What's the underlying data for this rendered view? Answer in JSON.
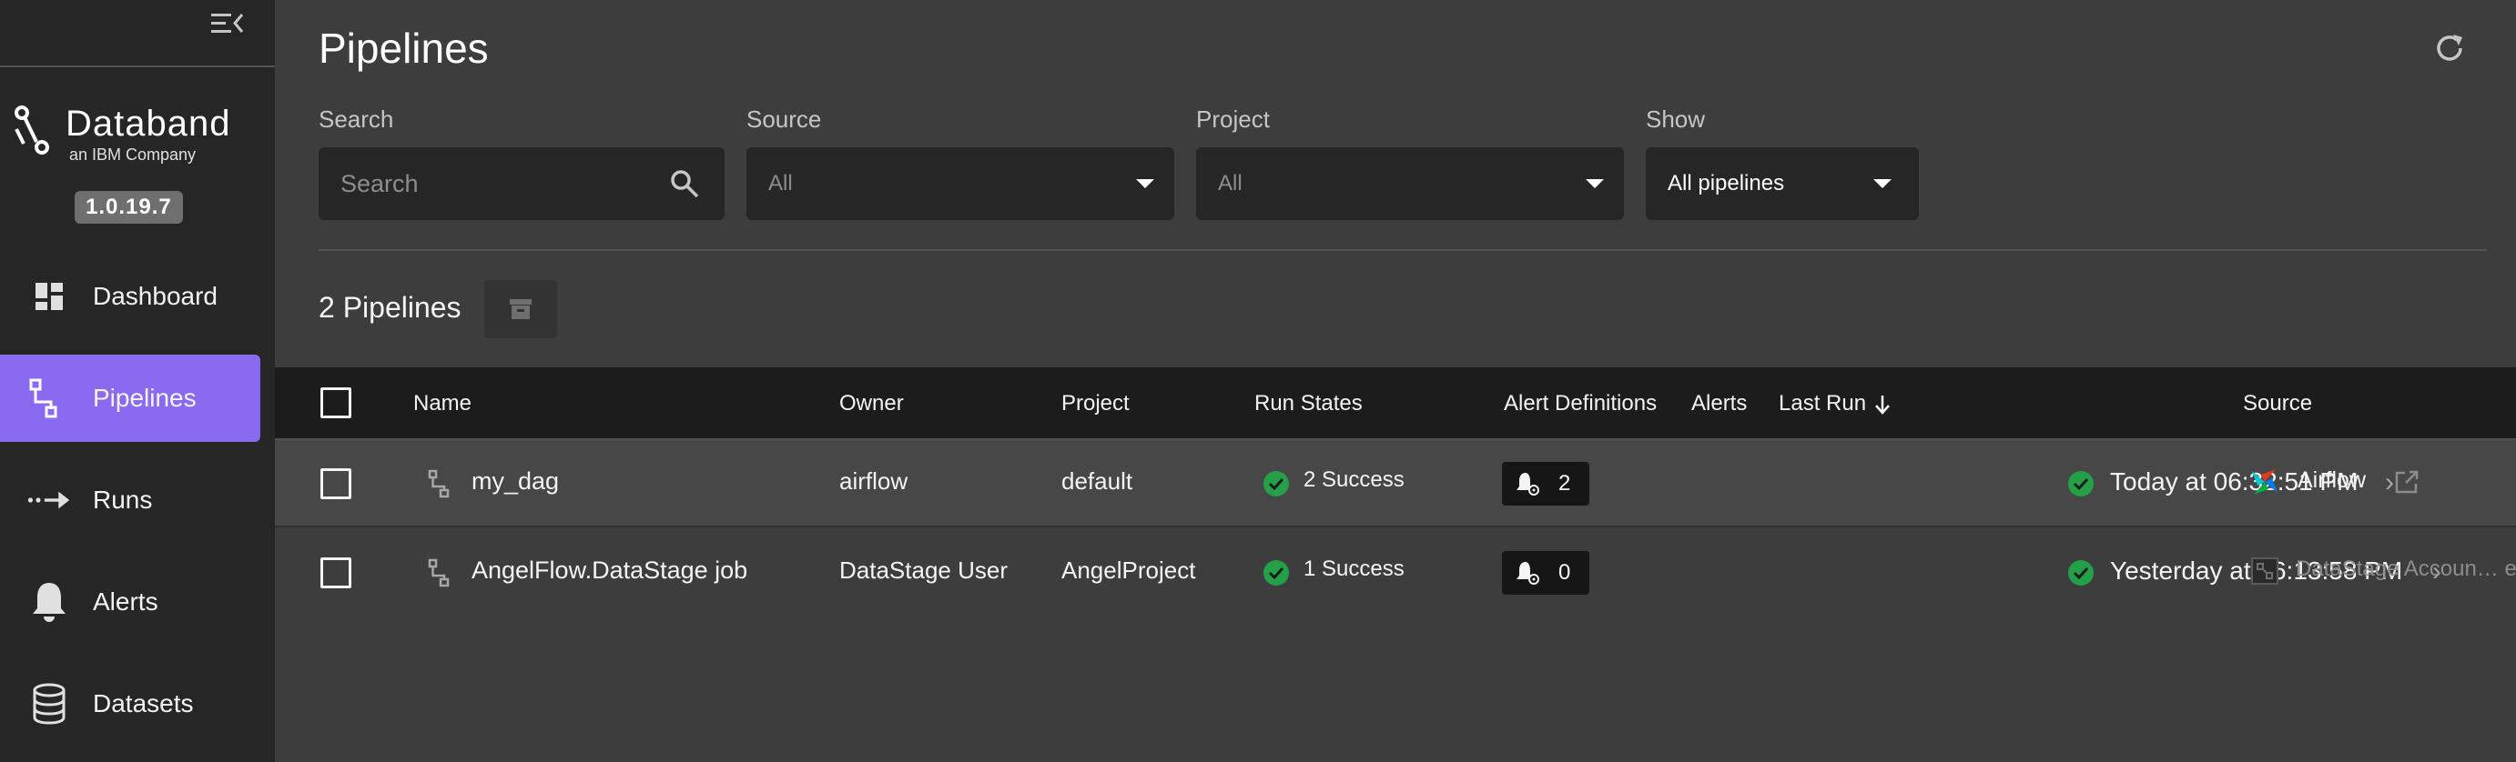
{
  "sidebar": {
    "logo_name": "Databand",
    "logo_sub": "an IBM Company",
    "version": "1.0.19.7",
    "items": [
      {
        "label": "Dashboard",
        "icon": "dashboard-icon"
      },
      {
        "label": "Pipelines",
        "icon": "pipelines-icon",
        "active": true
      },
      {
        "label": "Runs",
        "icon": "runs-icon"
      },
      {
        "label": "Alerts",
        "icon": "bell-icon"
      },
      {
        "label": "Datasets",
        "icon": "database-icon"
      }
    ]
  },
  "page": {
    "title": "Pipelines"
  },
  "filters": {
    "search": {
      "label": "Search",
      "placeholder": "Search"
    },
    "source": {
      "label": "Source",
      "value": "All"
    },
    "project": {
      "label": "Project",
      "value": "All"
    },
    "show": {
      "label": "Show",
      "value": "All pipelines"
    }
  },
  "summary": {
    "count_label": "2 Pipelines"
  },
  "table": {
    "columns": [
      "Name",
      "Owner",
      "Project",
      "Run States",
      "Alert Definitions",
      "Alerts",
      "Last Run",
      "Source"
    ],
    "sort_icon": "arrow-down-icon",
    "rows": [
      {
        "name": "my_dag",
        "owner": "airflow",
        "project": "default",
        "run_states": "2 Success",
        "alert_definitions": "2",
        "last_run": "Today at 06:32:51 PM",
        "source": "Airflow",
        "source_icon": "airflow-icon"
      },
      {
        "name": "AngelFlow.DataStage job",
        "owner": "DataStage User",
        "project": "AngelProject",
        "run_states": "1 Success",
        "alert_definitions": "0",
        "last_run": "Yesterday at 06:13:58 PM",
        "source": "DataStage Accoun… e",
        "source_icon": "datastage-icon"
      }
    ]
  },
  "colors": {
    "accent": "#8a6bf0",
    "success": "#24a148",
    "sidebar_bg": "#262626",
    "main_bg": "#3d3d3d"
  }
}
